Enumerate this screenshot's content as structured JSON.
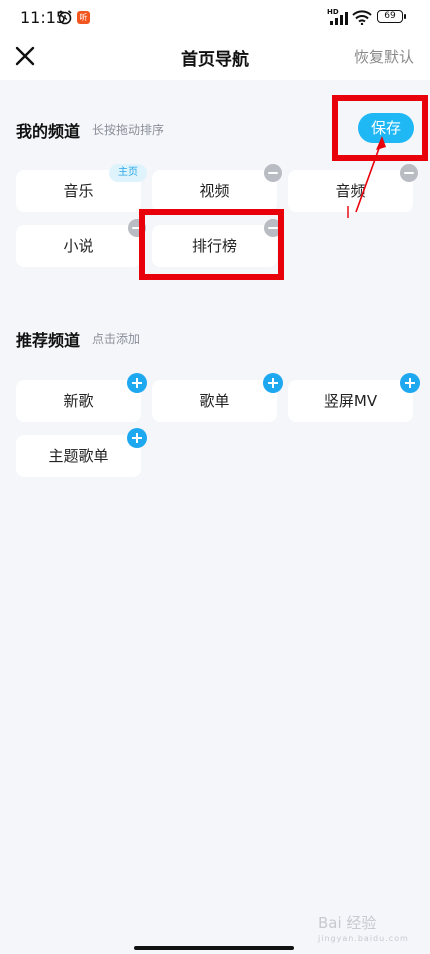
{
  "status_bar": {
    "time": "11:15",
    "app_badge": "听",
    "network": "HD",
    "battery": "69"
  },
  "nav": {
    "title": "首页导航",
    "restore_label": "恢复默认"
  },
  "my_channels": {
    "title": "我的频道",
    "hint": "长按拖动排序",
    "save_label": "保存",
    "home_badge": "主页",
    "items": [
      "音乐",
      "视频",
      "音频",
      "小说",
      "排行榜"
    ]
  },
  "recommended": {
    "title": "推荐频道",
    "hint": "点击添加",
    "items": [
      "新歌",
      "歌单",
      "竖屏MV",
      "主题歌单"
    ]
  },
  "watermark": {
    "text": "Bai 经验",
    "sub": "jingyan.baidu.com"
  },
  "colors": {
    "accent": "#1fb8f5",
    "plus": "#1ea8f0",
    "highlight": "#e8000b",
    "background": "#f5f6fa"
  }
}
